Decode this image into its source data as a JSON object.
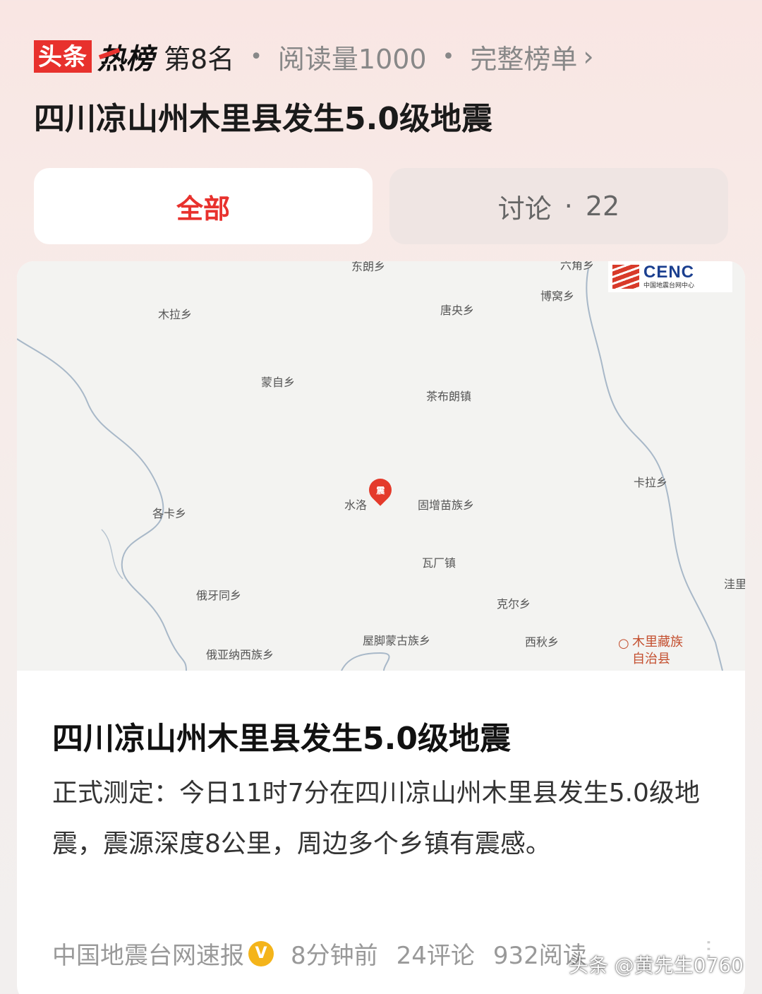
{
  "hot_header": {
    "logo_toutiao": "头条",
    "logo_rebang": "热榜",
    "rank": "第8名",
    "separator": "•",
    "reads": "阅读量1000",
    "full_list": "完整榜单",
    "chevron": "›"
  },
  "hot_title": "四川凉山州木里县发生5.0级地震",
  "tabs": {
    "all": "全部",
    "discuss_label": "讨论",
    "discuss_sep": "·",
    "discuss_count": "22"
  },
  "map": {
    "logo_word": "CENC",
    "logo_sub": "中国地震台网中心",
    "pin_label": "震",
    "places": {
      "dongduo": "东朗乡",
      "liujuan": "六角乡",
      "mula": "木拉乡",
      "tangyang": "唐央乡",
      "bowo": "博窝乡",
      "mengzi": "蒙自乡",
      "chabulang": "茶布朗镇",
      "kala": "卡拉乡",
      "shuiluo": "水洛",
      "guozeng": "固增苗族乡",
      "yika": "各卡乡",
      "wachang": "瓦厂镇",
      "eyatong": "俄牙同乡",
      "keer": "克尔乡",
      "wuli": "洼里",
      "wujiao": "屋脚蒙古族乡",
      "xiqiu": "西秋乡",
      "eyana": "俄亚纳西族乡",
      "county_line1": "木里藏族",
      "county_line2": "自治县"
    }
  },
  "card": {
    "title": "四川凉山州木里县发生5.0级地震",
    "body": "正式测定：今日11时7分在四川凉山州木里县发生5.0级地震，震源深度8公里，周边多个乡镇有震感。",
    "source": "中国地震台网速报",
    "verified_icon": "V",
    "time": "8分钟前",
    "comments": "24评论",
    "reads": "932阅读",
    "more": "···"
  },
  "watermark": "头条 @黄先生0760",
  "colors": {
    "accent_red": "#e8312d",
    "verified_yellow": "#f4b41a",
    "text_muted": "#999999"
  }
}
